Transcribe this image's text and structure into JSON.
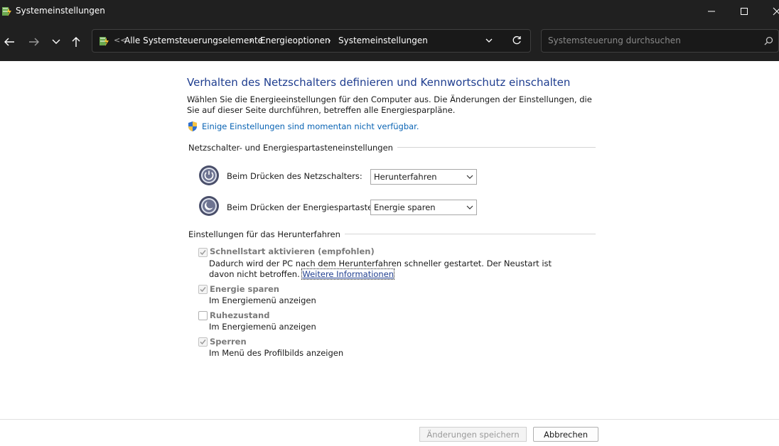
{
  "window": {
    "title": "Systemeinstellungen",
    "icons": {
      "app": "power-options-icon",
      "minimize": "minimize-icon",
      "maximize": "maximize-icon",
      "close": "close-icon"
    }
  },
  "navigation": {
    "breadcrumb_overflow": "<<",
    "breadcrumbs": [
      "Alle Systemsteuerungselemente",
      "Energieoptionen",
      "Systemeinstellungen"
    ],
    "separator": "›",
    "search_placeholder": "Systemsteuerung durchsuchen",
    "icons": [
      "back-arrow-icon",
      "forward-arrow-icon",
      "recent-locations-icon",
      "up-arrow-icon",
      "refresh-icon",
      "search-icon"
    ]
  },
  "main": {
    "heading": "Verhalten des Netzschalters definieren und Kennwortschutz einschalten",
    "intro": "Wählen Sie die Energieeinstellungen für den Computer aus. Die Änderungen der Einstellungen, die Sie auf dieser Seite durchführen, betreffen alle Energiesparpläne.",
    "unavailable_link": "Einige Einstellungen sind momentan nicht verfügbar.",
    "power_section": {
      "title": "Netzschalter- und Energiespartasteneinstellungen",
      "settings": [
        {
          "label": "Beim Drücken des Netzschalters:",
          "value": "Herunterfahren",
          "icon": "power-button-icon"
        },
        {
          "label": "Beim Drücken der Energiespartaste:",
          "value": "Energie sparen",
          "icon": "sleep-button-icon"
        }
      ]
    },
    "shutdown_section": {
      "title": "Einstellungen für das Herunterfahren",
      "options": [
        {
          "title": "Schnellstart aktivieren (empfohlen)",
          "desc": "Dadurch wird der PC nach dem Herunterfahren schneller gestartet. Der Neustart ist davon nicht betroffen.",
          "link": "Weitere Informationen",
          "checked": true
        },
        {
          "title": "Energie sparen",
          "desc": "Im Energiemenü anzeigen",
          "checked": true
        },
        {
          "title": "Ruhezustand",
          "desc": "Im Energiemenü anzeigen",
          "checked": false
        },
        {
          "title": "Sperren",
          "desc": "Im Menü des Profilbilds anzeigen",
          "checked": true
        }
      ]
    }
  },
  "footer": {
    "save_label": "Änderungen speichern",
    "cancel_label": "Abbrechen"
  },
  "colors": {
    "titlebar_bg": "#202020",
    "heading": "#1e3d8f",
    "link": "#0a64b4",
    "disabled_text": "#7a7a7a"
  }
}
